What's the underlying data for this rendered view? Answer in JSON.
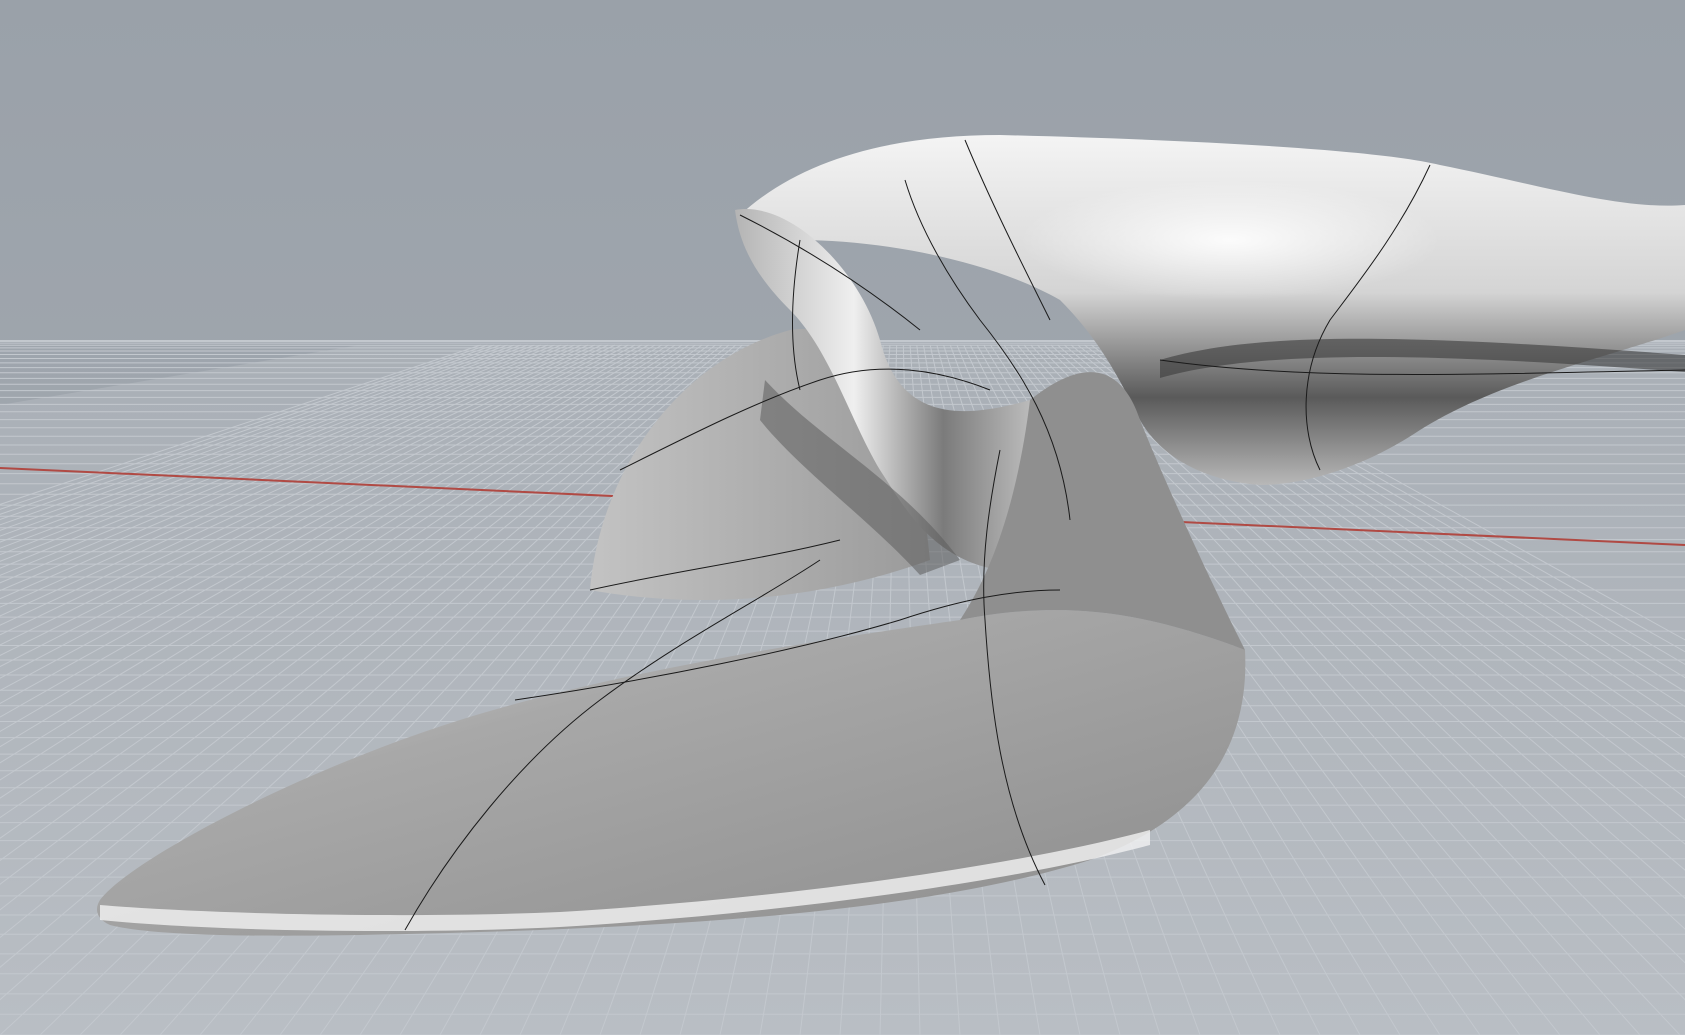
{
  "viewport": {
    "view": "perspective",
    "display_mode": "shaded",
    "background_color": "#9aa1a9",
    "grid_color": "#aeb4bb",
    "grid_line_color": "#c4c9cf",
    "x_axis_color": "#b04a44",
    "surface_color": "#a9a9a9",
    "isocurve_color": "#1a1a1a"
  },
  "objects": [
    {
      "name": "freeform-nurbs-surface",
      "type": "surface",
      "selected": false
    }
  ]
}
